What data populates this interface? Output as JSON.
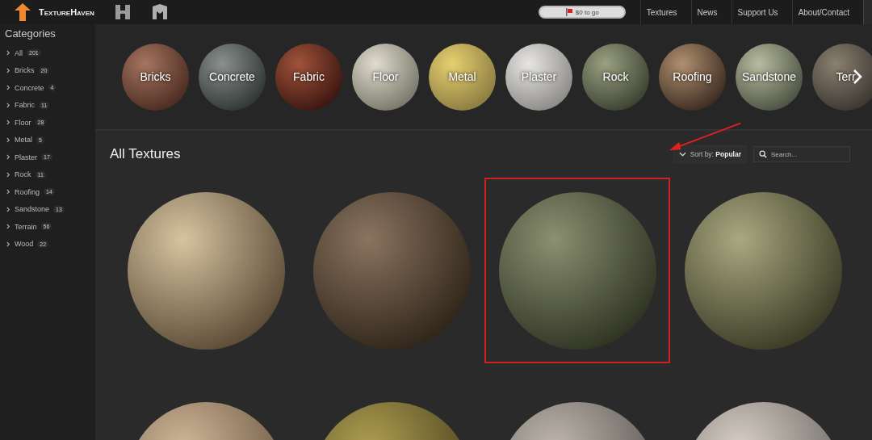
{
  "header": {
    "logo": "TextureHaven",
    "donation": "$0 to go",
    "nav": [
      {
        "label": "Textures"
      },
      {
        "label": "News"
      },
      {
        "label": "Support Us"
      },
      {
        "label": "About/Contact"
      }
    ]
  },
  "sidebar": {
    "title": "Categories",
    "items": [
      {
        "label": "All",
        "count": "201"
      },
      {
        "label": "Bricks",
        "count": "20"
      },
      {
        "label": "Concrete",
        "count": "4"
      },
      {
        "label": "Fabric",
        "count": "11"
      },
      {
        "label": "Floor",
        "count": "28"
      },
      {
        "label": "Metal",
        "count": "5"
      },
      {
        "label": "Plaster",
        "count": "17"
      },
      {
        "label": "Rock",
        "count": "11"
      },
      {
        "label": "Roofing",
        "count": "14"
      },
      {
        "label": "Sandstone",
        "count": "13"
      },
      {
        "label": "Terrain",
        "count": "56"
      },
      {
        "label": "Wood",
        "count": "22"
      }
    ]
  },
  "banner": {
    "categories": [
      {
        "label": "Bricks"
      },
      {
        "label": "Concrete"
      },
      {
        "label": "Fabric"
      },
      {
        "label": "Floor"
      },
      {
        "label": "Metal"
      },
      {
        "label": "Plaster"
      },
      {
        "label": "Rock"
      },
      {
        "label": "Roofing"
      },
      {
        "label": "Sandstone"
      },
      {
        "label": "Terr"
      }
    ]
  },
  "main": {
    "title": "All Textures",
    "sort_label": "Sort by:",
    "sort_value": "Popular",
    "search": {
      "placeholder": "Search..."
    },
    "textures": [
      {
        "highlighted": false
      },
      {
        "highlighted": false
      },
      {
        "highlighted": true
      },
      {
        "highlighted": false
      },
      {
        "highlighted": false
      },
      {
        "highlighted": false
      },
      {
        "highlighted": false
      },
      {
        "highlighted": false
      }
    ]
  }
}
